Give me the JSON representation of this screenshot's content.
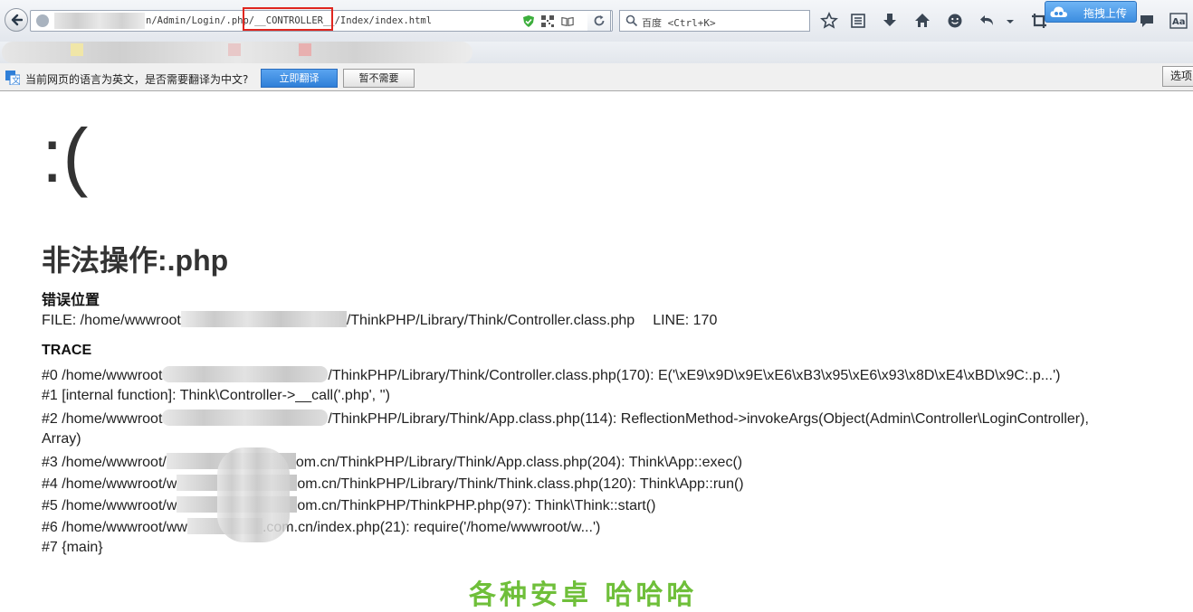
{
  "browser": {
    "url_text": "n/Admin/Login/.php/__CONTROLLER__/Index/index.html",
    "search_placeholder": "百度 <Ctrl+K>",
    "upload_label": "拖拽上传"
  },
  "translate_bar": {
    "message": "当前网页的语言为英文，是否需要翻译为中文?",
    "translate_button": "立即翻译",
    "decline_button": "暂不需要",
    "options_button": "选项"
  },
  "page": {
    "face": ":(",
    "title": "非法操作:.php",
    "location_heading": "错误位置",
    "file_line": {
      "prefix": "FILE: /home/wwwroot",
      "suffix": "/ThinkPHP/Library/Think/Controller.class.php",
      "line": "LINE: 170"
    },
    "trace_heading": "TRACE",
    "trace": [
      {
        "prefix": "#0 /home/wwwroot",
        "suffix": "/ThinkPHP/Library/Think/Controller.class.php(170): E('\\xE9\\x9D\\x9E\\xE6\\xB3\\x95\\xE6\\x93\\x8D\\xE4\\xBD\\x9C:.p...')"
      },
      {
        "prefix": "#1 [internal function]: Think\\Controller->__call('.php', '')",
        "suffix": ""
      },
      {
        "prefix": "#2 /home/wwwroot",
        "suffix": "/ThinkPHP/Library/Think/App.class.php(114): ReflectionMethod->invokeArgs(Object(Admin\\Controller\\LoginController),"
      },
      {
        "prefix": "Array)",
        "suffix": ""
      },
      {
        "prefix": "#3 /home/wwwroot/",
        "suffix": "om.cn/ThinkPHP/Library/Think/App.class.php(204): Think\\App::exec()"
      },
      {
        "prefix": "#4 /home/wwwroot/w",
        "suffix": "om.cn/ThinkPHP/Library/Think/Think.class.php(120): Think\\App::run()"
      },
      {
        "prefix": "#5 /home/wwwroot/w",
        "suffix": "om.cn/ThinkPHP/ThinkPHP.php(97): Think\\Think::start()"
      },
      {
        "prefix": "#6 /home/wwwroot/ww",
        "suffix": ".com.cn/index.php(21): require('/home/wwwroot/w...')"
      },
      {
        "prefix": "#7 {main}",
        "suffix": ""
      }
    ],
    "footer_text": "各种安卓 哈哈哈"
  },
  "colors": {
    "highlight_box": "#e0261f",
    "translate_accent": "#2f7fd8",
    "footer_green": "#6fbf3a"
  }
}
